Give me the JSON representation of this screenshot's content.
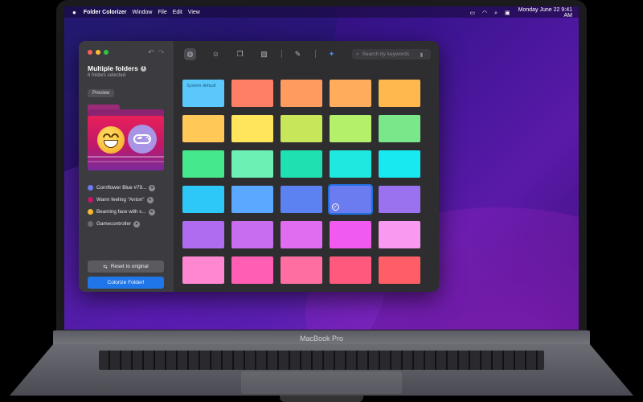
{
  "menubar": {
    "app_name": "Folder Colorizer",
    "items": [
      "Window",
      "File",
      "Edit",
      "View"
    ],
    "clock_line1": "Monday June 22",
    "clock_time": "9:41",
    "clock_ampm": "AM"
  },
  "laptop": {
    "model_label": "MacBook Pro"
  },
  "sidebar": {
    "title": "Multiple folders",
    "subtitle": "6 folders selected",
    "preview_label": "Preview",
    "tags": [
      {
        "label": "Cornflower Blue #79...",
        "color": "#6b7cf0"
      },
      {
        "label": "Warm feeling \"Anton\"",
        "color": "#c0186a"
      },
      {
        "label": "Beaming face with s...",
        "color": "#f5b82e"
      },
      {
        "label": "Gamecontroller",
        "color": "#6a6a70"
      }
    ],
    "reset_label": "Reset to original",
    "colorize_label": "Colorize Folder!"
  },
  "toolbar": {
    "search_placeholder": "Search by keywords",
    "icons": [
      "palette-icon",
      "emoji-icon",
      "copy-icon",
      "image-icon",
      "eyedropper-icon",
      "magic-icon"
    ]
  },
  "palette": {
    "system_default_label": "System default",
    "selected_index": 18,
    "rows": [
      [
        "#5ac8fa",
        "#ff7f66",
        "#ff9b5e",
        "#ffad5c",
        "#ffb84d"
      ],
      [
        "#ffc857",
        "#ffe55c",
        "#c8e65a",
        "#b5f06a",
        "#7ae88a"
      ],
      [
        "#45e88c",
        "#6cf0b4",
        "#1fe0b0",
        "#1ee8e0",
        "#18e8f0"
      ],
      [
        "#2ec8f8",
        "#5aa8ff",
        "#5b82f0",
        "#6b7cf0",
        "#9a72f0"
      ],
      [
        "#b06cf0",
        "#c86cf0",
        "#e06cf0",
        "#f05aee",
        "#f89af0"
      ],
      [
        "#ff86d0",
        "#ff5eb4",
        "#ff6ea0",
        "#ff5a7e",
        "#ff5e66"
      ]
    ]
  }
}
